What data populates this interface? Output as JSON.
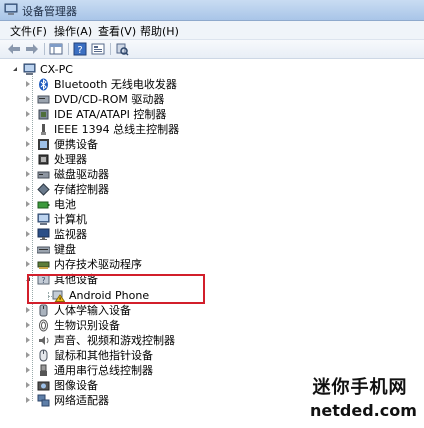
{
  "window": {
    "title": "设备管理器"
  },
  "menu": [
    "文件(F)",
    "操作(A)",
    "查看(V)",
    "帮助(H)"
  ],
  "toolbar": [
    "back-icon",
    "forward-icon",
    "console-tree-icon",
    "help-icon",
    "properties-icon",
    "scan-hardware-icon"
  ],
  "tree": {
    "root": "CX-PC",
    "items": [
      {
        "label": "Bluetooth 无线电收发器",
        "icon": "bluetooth-icon"
      },
      {
        "label": "DVD/CD-ROM 驱动器",
        "icon": "dvd-icon"
      },
      {
        "label": "IDE ATA/ATAPI 控制器",
        "icon": "ide-icon"
      },
      {
        "label": "IEEE 1394 总线主控制器",
        "icon": "firewire-icon"
      },
      {
        "label": "便携设备",
        "icon": "portable-device-icon"
      },
      {
        "label": "处理器",
        "icon": "processor-icon"
      },
      {
        "label": "磁盘驱动器",
        "icon": "disk-drive-icon"
      },
      {
        "label": "存储控制器",
        "icon": "storage-controller-icon"
      },
      {
        "label": "电池",
        "icon": "battery-icon"
      },
      {
        "label": "计算机",
        "icon": "computer-icon"
      },
      {
        "label": "监视器",
        "icon": "monitor-icon"
      },
      {
        "label": "键盘",
        "icon": "keyboard-icon"
      },
      {
        "label": "内存技术驱动程序",
        "icon": "memory-icon"
      },
      {
        "label": "其他设备",
        "icon": "other-devices-icon",
        "expanded": true,
        "children": [
          {
            "label": "Android Phone",
            "icon": "unknown-device-warning-icon"
          }
        ]
      },
      {
        "label": "人体学输入设备",
        "icon": "hid-icon"
      },
      {
        "label": "生物识别设备",
        "icon": "biometric-icon"
      },
      {
        "label": "声音、视频和游戏控制器",
        "icon": "sound-icon"
      },
      {
        "label": "鼠标和其他指针设备",
        "icon": "mouse-icon"
      },
      {
        "label": "通用串行总线控制器",
        "icon": "usb-icon"
      },
      {
        "label": "图像设备",
        "icon": "imaging-icon"
      },
      {
        "label": "网络适配器",
        "icon": "network-adapter-icon"
      }
    ]
  },
  "watermark": {
    "line1": "迷你手机网",
    "line2": "netded.com"
  }
}
